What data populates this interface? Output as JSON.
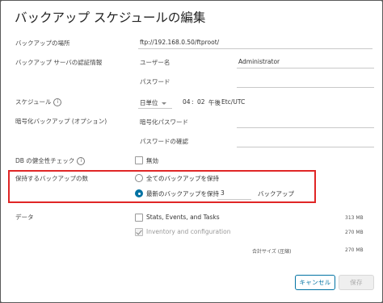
{
  "dialog": {
    "title": "バックアップ スケジュールの編集"
  },
  "location": {
    "label": "バックアップの場所",
    "value": "ftp://192.168.0.50/ftproot/"
  },
  "credentials": {
    "label": "バックアップ サーバの認証情報",
    "username_label": "ユーザー名",
    "username_value": "Administrator",
    "password_label": "パスワード"
  },
  "schedule": {
    "label": "スケジュール",
    "frequency": "日単位",
    "hour": "04",
    "colon": ":",
    "minute": "02",
    "period": "午後",
    "timezone": "Etc/UTC"
  },
  "encryption": {
    "label": "暗号化バックアップ (オプション)",
    "password_label": "暗号化パスワード",
    "confirm_label": "パスワードの確認"
  },
  "db_check": {
    "label": "DB の健全性チェック",
    "option_label": "無効",
    "checked": false
  },
  "retention": {
    "label": "保持するバックアップの数",
    "keep_all_label": "全てのバックアップを保持",
    "keep_latest_label": "最新のバックアップを保持",
    "keep_latest_value": "3",
    "unit": "バックアップ",
    "selected": "keep_latest"
  },
  "data": {
    "label": "データ",
    "items": [
      {
        "label": "Stats, Events, and Tasks",
        "size": "313 MB",
        "checked": false,
        "disabled": false
      },
      {
        "label": "Inventory and configuration",
        "size": "270 MB",
        "checked": true,
        "disabled": true
      }
    ],
    "total_label": "合計サイズ (圧縮)",
    "total_size": "270 MB"
  },
  "footer": {
    "cancel_label": "キャンセル",
    "save_label": "保存"
  },
  "colors": {
    "accent": "#0072a3",
    "highlight_border": "#e02626"
  }
}
